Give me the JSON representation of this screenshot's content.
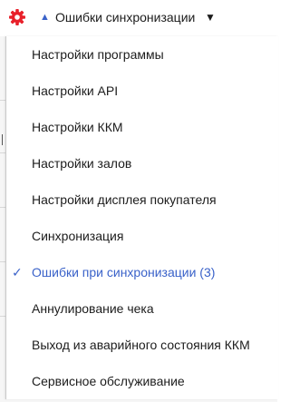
{
  "header": {
    "sort_arrow": "▲",
    "title": "Ошибки синхронизации",
    "caret": "▼"
  },
  "menu": {
    "check_mark": "✓",
    "items": [
      {
        "label": "Настройки программы"
      },
      {
        "label": "Настройки API"
      },
      {
        "label": "Настройки ККМ"
      },
      {
        "label": "Настройки залов"
      },
      {
        "label": "Настройки дисплея покупателя"
      },
      {
        "label": "Синхронизация"
      },
      {
        "label": "Ошибки при синхронизации (3)",
        "selected": true
      },
      {
        "label": "Аннулирование чека"
      },
      {
        "label": "Выход из аварийного состояния ККМ"
      },
      {
        "label": "Сервисное обслуживание"
      }
    ]
  },
  "colors": {
    "accent": "#3a62c9",
    "gear": "#e8202a",
    "text": "#1c1c1c"
  },
  "icons": {
    "settings": "gear-icon",
    "sort": "sort-up-icon",
    "dropdown": "chevron-down-icon",
    "selected": "check-icon"
  }
}
